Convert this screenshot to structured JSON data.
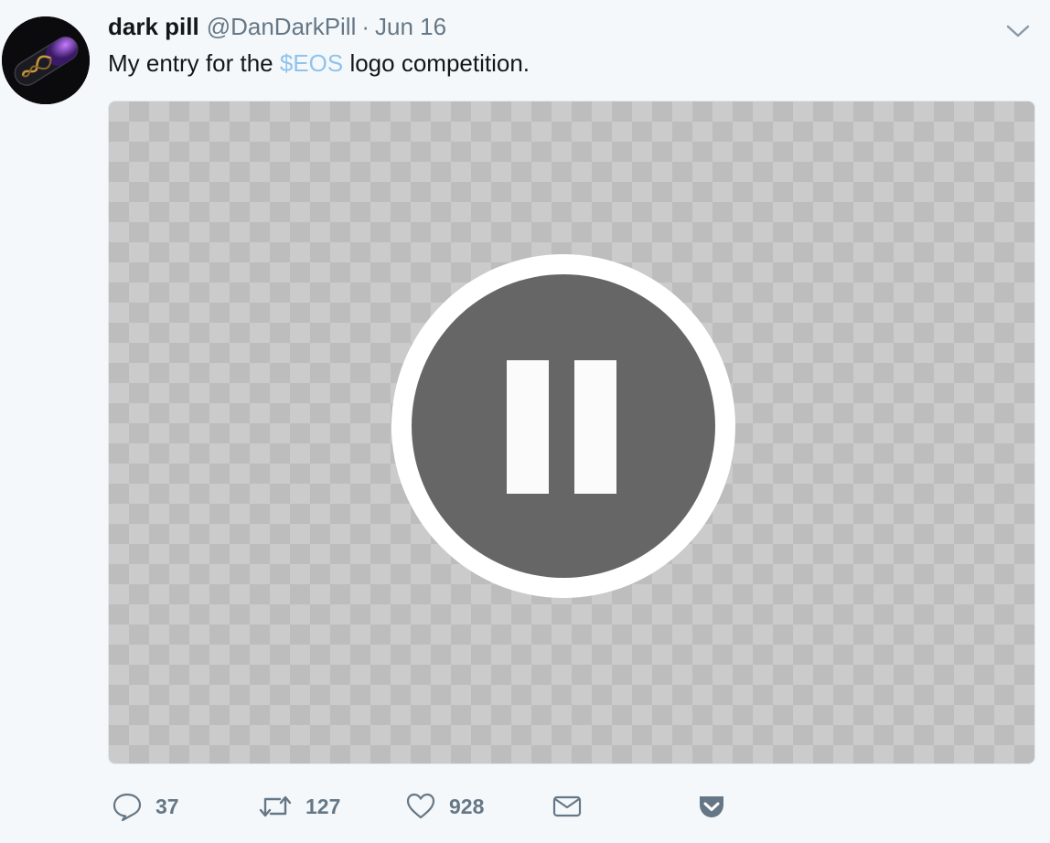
{
  "tweet": {
    "display_name": "dark pill",
    "handle": "@DanDarkPill",
    "separator": "·",
    "time": "Jun 16",
    "text_before": "My entry for the ",
    "cashtag": "$EOS",
    "text_after": " logo competition."
  },
  "media": {
    "control_icon": "pause-icon"
  },
  "actions": {
    "reply_count": "37",
    "retweet_count": "127",
    "like_count": "928"
  },
  "colors": {
    "cashtag": "#8fc3ee",
    "muted": "#657786",
    "text": "#14171a",
    "pause_fill": "#666666"
  }
}
